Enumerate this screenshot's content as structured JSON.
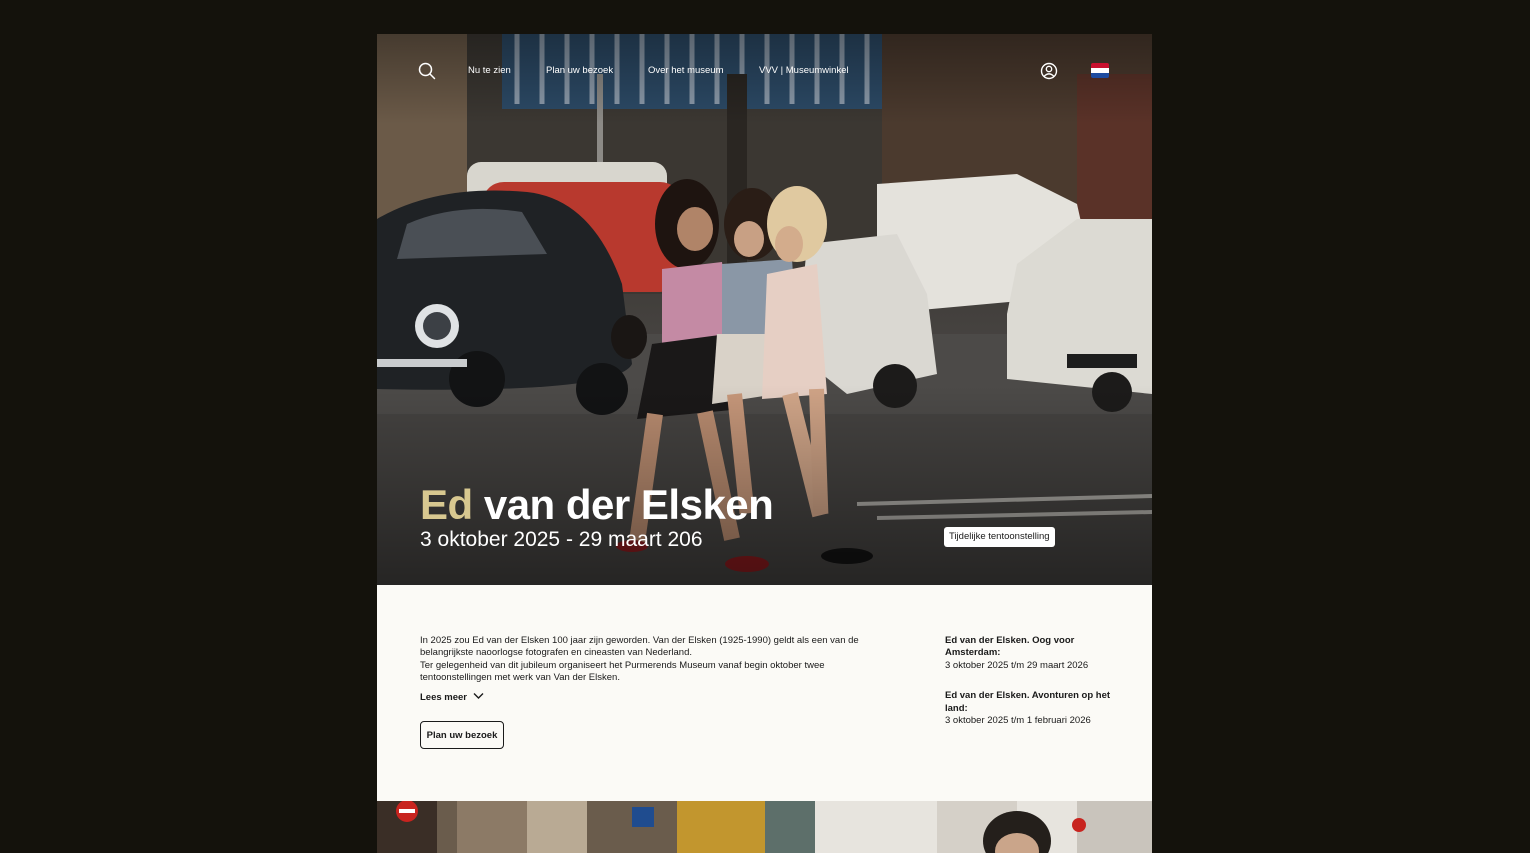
{
  "nav": {
    "links": [
      "Nu te zien",
      "Plan uw bezoek",
      "Over het museum",
      "VVV | Museumwinkel"
    ],
    "search_icon": "search-icon",
    "user_icon": "user-icon",
    "flag_icon": "flag-nl-icon"
  },
  "hero": {
    "title_accent": "Ed",
    "title_rest": " van der Elsken",
    "dates": "3 oktober 2025 - 29 maart 206",
    "badge": "Tijdelijke tentoonstelling"
  },
  "intro": {
    "p1": "In 2025 zou Ed van der Elsken 100 jaar zijn geworden. Van der Elsken (1925-1990) geldt als een van de belangrijkste naoorlogse fotografen en cineasten van Nederland.",
    "p2": "Ter gelegenheid van dit jubileum organiseert het Purmerends Museum vanaf begin oktober twee tentoonstellingen met werk van Van der Elsken.",
    "read_more": "Lees meer",
    "button": "Plan uw bezoek"
  },
  "exhibitions": [
    {
      "title": "Ed van der Elsken. Oog voor Amsterdam:",
      "dates": "3 oktober 2025 t/m 29 maart 2026"
    },
    {
      "title": "Ed van der Elsken. Avonturen op het land:",
      "dates": "3 oktober 2025 t/m 1 februari 2026"
    }
  ],
  "colors": {
    "background": "#14120c",
    "page": "#fbfaf6",
    "accent": "#d8c890",
    "text": "#1a1a1a"
  }
}
